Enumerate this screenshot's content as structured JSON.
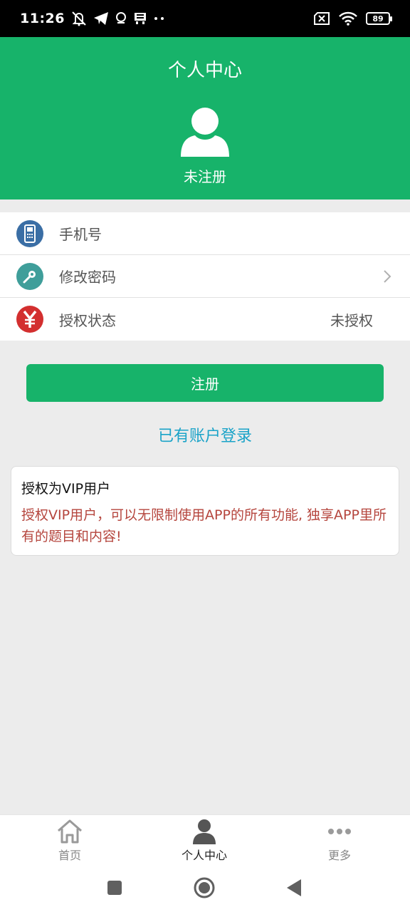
{
  "status_bar": {
    "time": "11:26",
    "battery": "89",
    "icons_left": [
      "mute-icon",
      "telegram-icon",
      "location-icon",
      "inbox-icon",
      "more-dots-icon"
    ],
    "icons_right": [
      "sim-off-icon",
      "wifi-icon",
      "battery-icon"
    ]
  },
  "header": {
    "title": "个人中心",
    "user_status": "未注册"
  },
  "menu": {
    "items": [
      {
        "label": "手机号",
        "value": "",
        "icon": "phone-icon",
        "icon_color": "#3a6ea5"
      },
      {
        "label": "修改密码",
        "value": "",
        "icon": "key-icon",
        "icon_color": "#3f9e9a",
        "chevron": true
      },
      {
        "label": "授权状态",
        "value": "未授权",
        "icon": "yen-icon",
        "icon_color": "#d32f2f"
      }
    ]
  },
  "actions": {
    "register_label": "注册",
    "login_link": "已有账户登录"
  },
  "vip_card": {
    "title": "授权为VIP用户",
    "description": "授权VIP用户，可以无限制使用APP的所有功能, 独享APP里所有的题目和内容!"
  },
  "tabbar": {
    "tabs": [
      {
        "label": "首页",
        "icon": "home-icon",
        "active": false
      },
      {
        "label": "个人中心",
        "icon": "person-icon",
        "active": true
      },
      {
        "label": "更多",
        "icon": "more-icon",
        "active": false
      }
    ]
  },
  "colors": {
    "primary_green": "#17b36a",
    "link_blue": "#1aa3c8",
    "vip_red": "#b5453d"
  }
}
